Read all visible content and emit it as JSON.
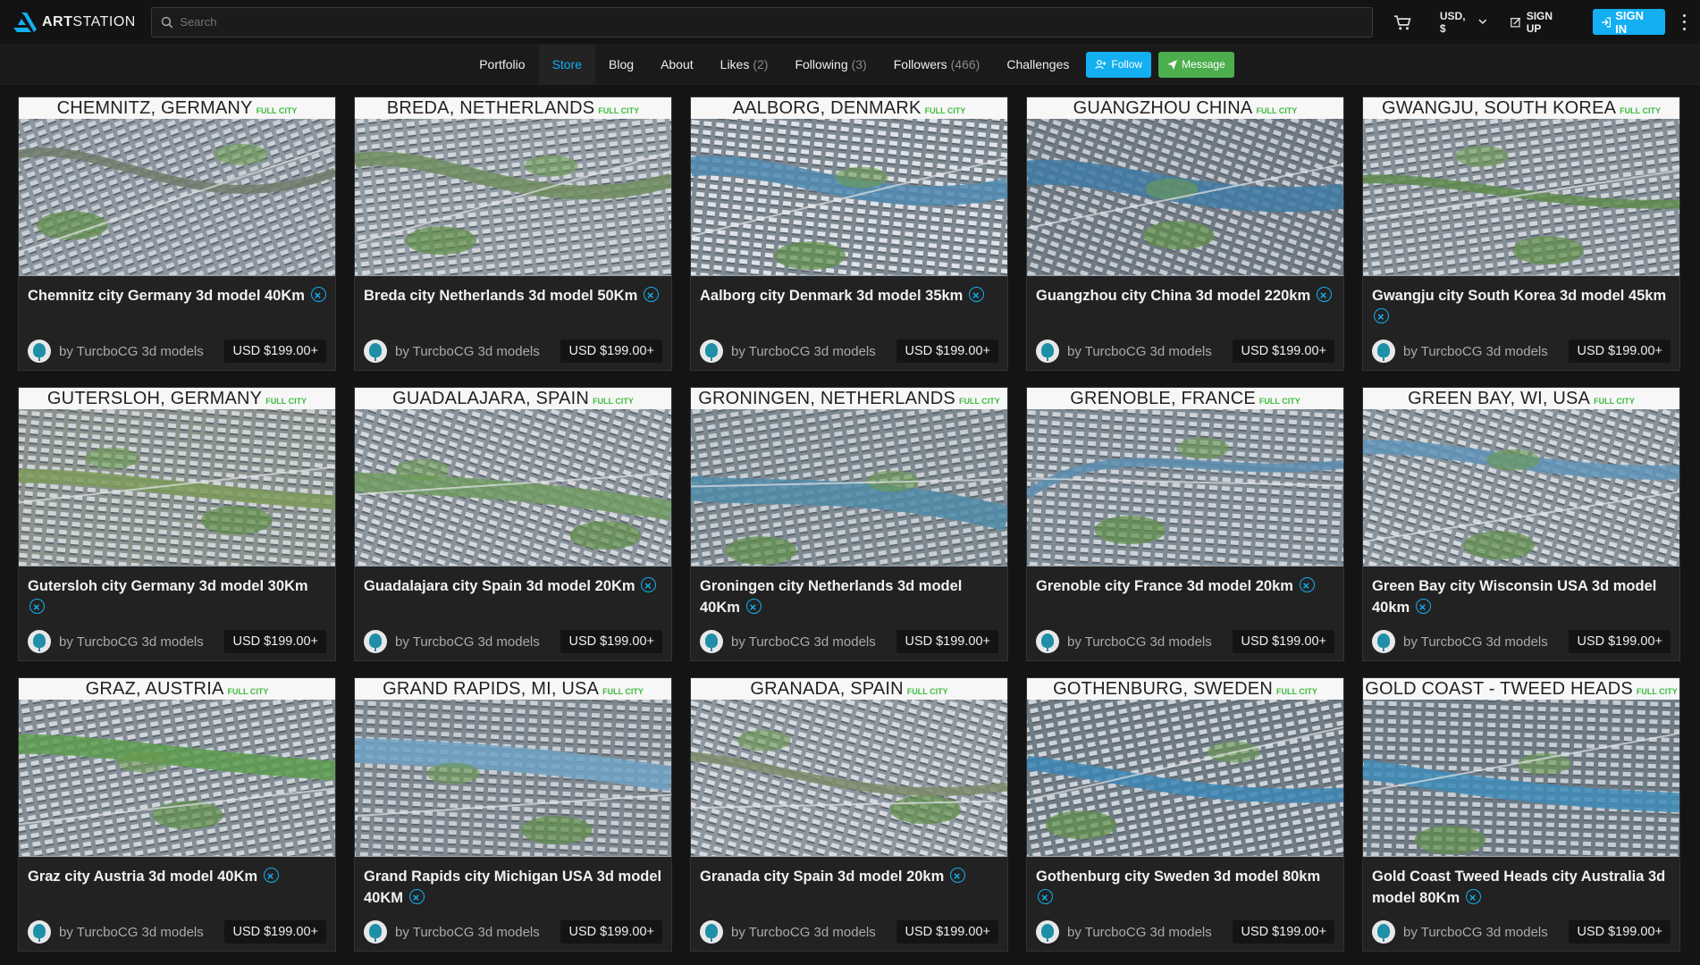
{
  "brand": {
    "name_bold": "ART",
    "name_rest": "STATION"
  },
  "search": {
    "placeholder": "Search"
  },
  "topbar": {
    "currency": "USD, $",
    "signup": "SIGN UP",
    "signin": "SIGN IN"
  },
  "nav": {
    "items": [
      {
        "label": "Portfolio",
        "count": ""
      },
      {
        "label": "Store",
        "count": ""
      },
      {
        "label": "Blog",
        "count": ""
      },
      {
        "label": "About",
        "count": ""
      },
      {
        "label": "Likes",
        "count": "(2)"
      },
      {
        "label": "Following",
        "count": "(3)"
      },
      {
        "label": "Followers",
        "count": "(466)"
      },
      {
        "label": "Challenges",
        "count": ""
      }
    ],
    "follow": "Follow",
    "message": "Message"
  },
  "colors": {
    "accent": "#13aff0",
    "green": "#4cae4c",
    "tag": "#3dbb3d"
  },
  "products": [
    {
      "city": "CHEMNITZ, GERMANY",
      "tag": "FULL CITY",
      "title": "Chemnitz city Germany 3d model 40Km",
      "author": "by TurcboCG 3d models",
      "price": "USD $199.00+"
    },
    {
      "city": "BREDA, NETHERLANDS",
      "tag": "FULL CITY",
      "title": "Breda city Netherlands 3d model 50Km",
      "author": "by TurcboCG 3d models",
      "price": "USD $199.00+"
    },
    {
      "city": "AALBORG, DENMARK",
      "tag": "FULL CITY",
      "title": "Aalborg city Denmark 3d model 35km",
      "author": "by TurcboCG 3d models",
      "price": "USD $199.00+"
    },
    {
      "city": "GUANGZHOU CHINA",
      "tag": "FULL CITY",
      "title": "Guangzhou city China 3d model 220km",
      "author": "by TurcboCG 3d models",
      "price": "USD $199.00+"
    },
    {
      "city": "GWANGJU, SOUTH KOREA",
      "tag": "FULL CITY",
      "title": "Gwangju city South Korea 3d model 45km",
      "author": "by TurcboCG 3d models",
      "price": "USD $199.00+"
    },
    {
      "city": "GUTERSLOH, GERMANY",
      "tag": "FULL CITY",
      "title": "Gutersloh city Germany 3d model 30Km",
      "author": "by TurcboCG 3d models",
      "price": "USD $199.00+"
    },
    {
      "city": "GUADALAJARA, SPAIN",
      "tag": "FULL CITY",
      "title": "Guadalajara city Spain 3d model 20Km",
      "author": "by TurcboCG 3d models",
      "price": "USD $199.00+"
    },
    {
      "city": "GRONINGEN, NETHERLANDS",
      "tag": "FULL CITY",
      "title": "Groningen city Netherlands 3d model 40Km",
      "author": "by TurcboCG 3d models",
      "price": "USD $199.00+"
    },
    {
      "city": "GRENOBLE, FRANCE",
      "tag": "FULL CITY",
      "title": "Grenoble city France 3d model 20km",
      "author": "by TurcboCG 3d models",
      "price": "USD $199.00+"
    },
    {
      "city": "GREEN BAY, WI, USA",
      "tag": "FULL CITY",
      "title": "Green Bay city Wisconsin USA 3d model 40km",
      "author": "by TurcboCG 3d models",
      "price": "USD $199.00+"
    },
    {
      "city": "GRAZ, AUSTRIA",
      "tag": "FULL CITY",
      "title": "Graz city Austria 3d model 40Km",
      "author": "by TurcboCG 3d models",
      "price": "USD $199.00+"
    },
    {
      "city": "GRAND RAPIDS, MI, USA",
      "tag": "FULL CITY",
      "title": "Grand Rapids city Michigan USA 3d model 40KM",
      "author": "by TurcboCG 3d models",
      "price": "USD $199.00+"
    },
    {
      "city": "GRANADA, SPAIN",
      "tag": "FULL CITY",
      "title": "Granada city Spain 3d model 20km",
      "author": "by TurcboCG 3d models",
      "price": "USD $199.00+"
    },
    {
      "city": "GOTHENBURG, SWEDEN",
      "tag": "FULL CITY",
      "title": "Gothenburg city Sweden 3d model 80km",
      "author": "by TurcboCG 3d models",
      "price": "USD $199.00+"
    },
    {
      "city": "GOLD COAST - TWEED HEADS",
      "tag": "FULL CITY",
      "title": "Gold Coast Tweed Heads city Australia 3d model 80Km",
      "author": "by TurcboCG 3d models",
      "price": "USD $199.00+"
    }
  ]
}
